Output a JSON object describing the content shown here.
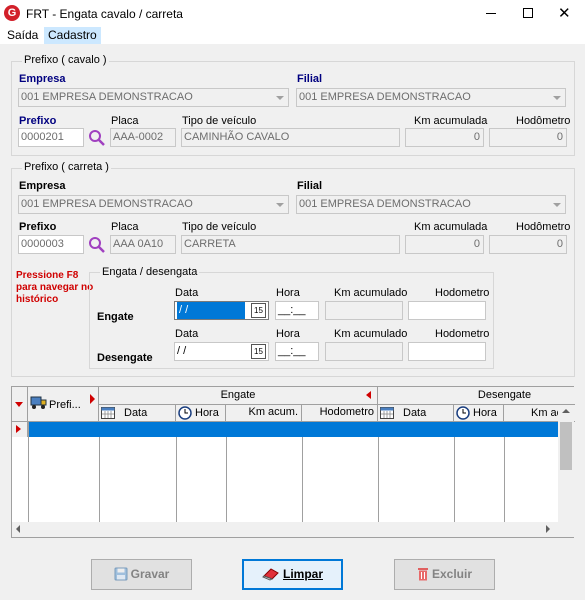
{
  "window": {
    "title": "FRT - Engata cavalo / carreta",
    "app_icon_letter": "G",
    "close_glyph": "✕"
  },
  "menu": {
    "saida": "Saída",
    "cadastro": "Cadastro"
  },
  "cavalo": {
    "legend": "Prefixo ( cavalo )",
    "empresa_label": "Empresa",
    "empresa_value": "001 EMPRESA DEMONSTRACAO",
    "filial_label": "Filial",
    "filial_value": "001 EMPRESA DEMONSTRACAO",
    "prefixo_label": "Prefixo",
    "prefixo_value": "0000201",
    "placa_label": "Placa",
    "placa_value": "AAA-0002",
    "tipo_label": "Tipo de veículo",
    "tipo_value": "CAMINHÃO CAVALO",
    "km_label": "Km acumulada",
    "km_value": "0",
    "hodometro_label": "Hodômetro",
    "hodometro_value": "0"
  },
  "carreta": {
    "legend": "Prefixo ( carreta )",
    "empresa_label": "Empresa",
    "empresa_value": "001 EMPRESA DEMONSTRACAO",
    "filial_label": "Filial",
    "filial_value": "001 EMPRESA DEMONSTRACAO",
    "prefixo_label": "Prefixo",
    "prefixo_value": "0000003",
    "placa_label": "Placa",
    "placa_value": "AAA 0A10",
    "tipo_label": "Tipo de veículo",
    "tipo_value": "CARRETA",
    "km_label": "Km acumulada",
    "km_value": "0",
    "hodometro_label": "Hodômetro",
    "hodometro_value": "0"
  },
  "hint": "Pressione F8 para navegar no histórico",
  "engata": {
    "legend": "Engata / desengata",
    "data_label": "Data",
    "hora_label": "Hora",
    "km_label": "Km acumulado",
    "hodometro_label": "Hodometro",
    "engate_label": "Engate",
    "desengate_label": "Desengate",
    "engate_date": " / /",
    "engate_time": "__:__",
    "desengate_date": " / /",
    "desengate_time": "__:__",
    "calendar_glyph": "15"
  },
  "grid": {
    "group_engate": "Engate",
    "group_desengate": "Desengate",
    "col_prefixo": "Prefi...",
    "col_data": "Data",
    "col_hora": "Hora",
    "col_km": "Km acum.",
    "col_hodometro": "Hodometro",
    "col_data2": "Data",
    "col_hora2": "Hora",
    "col_km2": "Km ac"
  },
  "buttons": {
    "gravar": "Gravar",
    "limpar": "Limpar",
    "excluir": "Excluir"
  },
  "colors": {
    "accent_blue": "#0078d7",
    "hint_red": "#d00000",
    "label_blue": "#000080"
  }
}
